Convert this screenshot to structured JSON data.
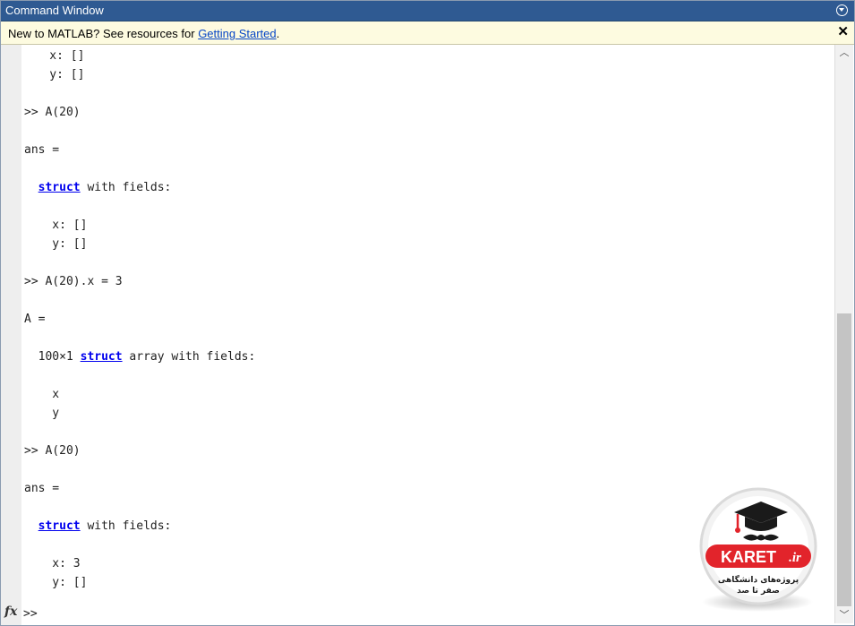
{
  "window": {
    "title": "Command Window"
  },
  "infobar": {
    "text": "New to MATLAB? See resources for ",
    "link": "Getting Started",
    "suffix": "."
  },
  "console": {
    "lines": [
      {
        "pre": "    x: []"
      },
      {
        "pre": "    y: []"
      },
      {
        "pre": ">> A(20)"
      },
      {
        "pre": "ans ="
      },
      {
        "pre": "  ",
        "kw": "struct",
        "post": " with fields:"
      },
      {
        "pre": "    x: []"
      },
      {
        "pre": "    y: []"
      },
      {
        "pre": ">> A(20).x = 3"
      },
      {
        "pre": "A ="
      },
      {
        "pre": "  100×1 ",
        "kw": "struct",
        "post": " array with fields:"
      },
      {
        "pre": "    x"
      },
      {
        "pre": "    y"
      },
      {
        "pre": ">> A(20)"
      },
      {
        "pre": "ans ="
      },
      {
        "pre": "  ",
        "kw": "struct",
        "post": " with fields:"
      },
      {
        "pre": "    x: 3"
      },
      {
        "pre": "    y: []"
      }
    ],
    "prompt": ">>"
  },
  "logo": {
    "brand": "KARET",
    "domain": ".ir",
    "tagline_line1": "پروژه‌های دانشگاهی",
    "tagline_line2": "صفر تا صد"
  },
  "colors": {
    "titlebar": "#2f5a92",
    "infobar": "#fdfbe0",
    "keyword": "#0000ee",
    "logo_red": "#e2242b"
  }
}
